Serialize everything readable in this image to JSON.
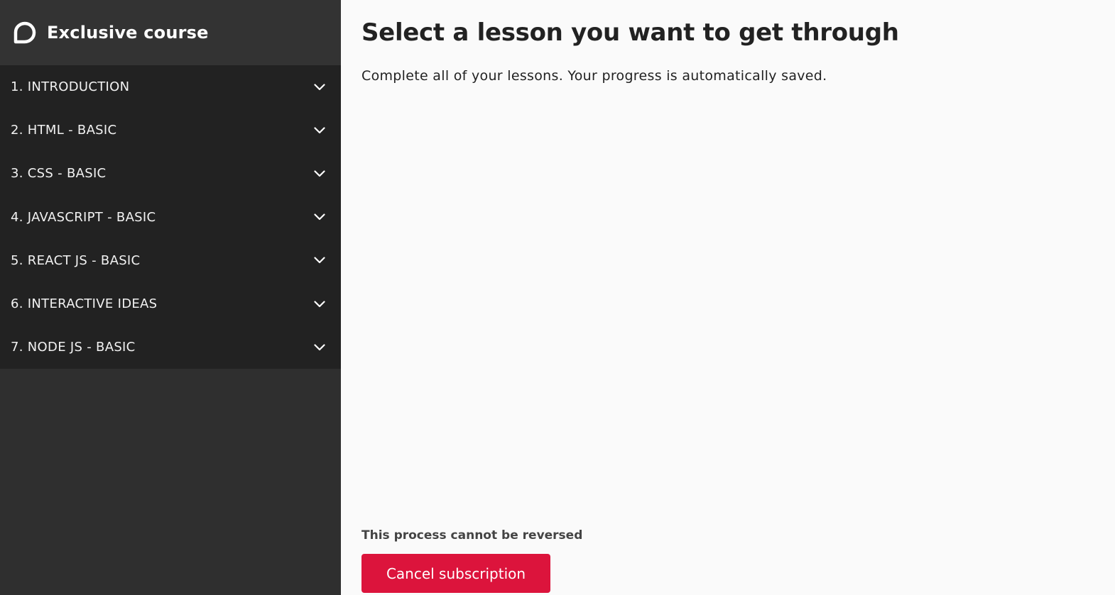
{
  "brand": {
    "title": "Exclusive course",
    "logo_icon": "chat-bubble-icon"
  },
  "sidebar": {
    "items": [
      {
        "label": "1. INTRODUCTION",
        "icon": "chevron-down-icon"
      },
      {
        "label": "2. HTML - BASIC",
        "icon": "chevron-down-icon"
      },
      {
        "label": "3. CSS - BASIC",
        "icon": "chevron-down-icon"
      },
      {
        "label": "4. JAVASCRIPT - BASIC",
        "icon": "chevron-down-icon"
      },
      {
        "label": "5. REACT JS - BASIC",
        "icon": "chevron-down-icon"
      },
      {
        "label": "6. INTERACTIVE IDEAS",
        "icon": "chevron-down-icon"
      },
      {
        "label": "7. NODE JS - BASIC",
        "icon": "chevron-down-icon"
      }
    ]
  },
  "main": {
    "title": "Select a lesson you want to get through",
    "subtitle": "Complete all of your lessons. Your progress is automatically saved.",
    "warning": "This process cannot be reversed",
    "cancel_label": "Cancel subscription"
  },
  "colors": {
    "sidebar_bg": "#2f2f2f",
    "list_bg": "#222222",
    "main_bg": "#fafafa",
    "accent": "#dc143c"
  }
}
